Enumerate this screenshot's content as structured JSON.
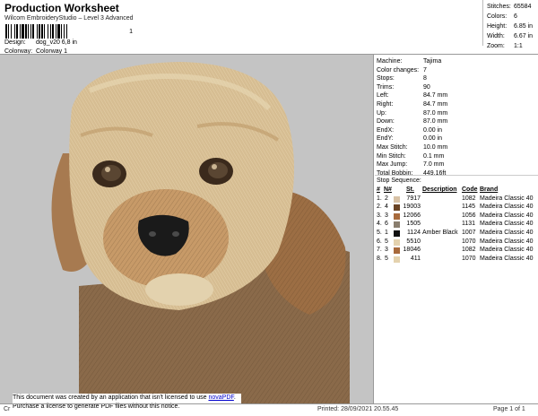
{
  "header": {
    "title": "Production Worksheet",
    "subtitle": "Wilcom EmbroideryStudio – Level 3 Advanced",
    "barcode_number": "1",
    "design_label": "Design:",
    "design_value": "dog_v20  6,8 in",
    "colorway_label": "Colorway:",
    "colorway_value": "Colorway 1"
  },
  "summary": [
    {
      "label": "Stitches:",
      "value": "65584"
    },
    {
      "label": "Colors:",
      "value": "6"
    },
    {
      "label": "Height:",
      "value": "6.85 in"
    },
    {
      "label": "Width:",
      "value": "6.67 in"
    },
    {
      "label": "Zoom:",
      "value": "1:1"
    }
  ],
  "params": [
    {
      "label": "Machine:",
      "value": "Tajima"
    },
    {
      "label": "Color changes:",
      "value": "7"
    },
    {
      "label": "Stops:",
      "value": "8"
    },
    {
      "label": "Trims:",
      "value": "90"
    },
    {
      "label": "Left:",
      "value": "84.7 mm"
    },
    {
      "label": "Right:",
      "value": "84.7 mm"
    },
    {
      "label": "Up:",
      "value": "87.0 mm"
    },
    {
      "label": "Down:",
      "value": "87.0 mm"
    },
    {
      "label": "EndX:",
      "value": "0.00 in"
    },
    {
      "label": "EndY:",
      "value": "0.00 in"
    },
    {
      "label": "Max Stitch:",
      "value": "10.0 mm"
    },
    {
      "label": "Min Stitch:",
      "value": "0.1 mm"
    },
    {
      "label": "Max Jump:",
      "value": "7.0 mm"
    },
    {
      "label": "Total Bobbin:",
      "value": "449.16ft"
    }
  ],
  "stop_sequence": {
    "heading": "Stop Sequence:",
    "columns": [
      "#",
      "N#",
      "St.",
      "Description",
      "Code",
      "Brand"
    ],
    "rows": [
      {
        "n": "1.",
        "id": "2",
        "color": "#d8c2a6",
        "st": "7917",
        "desc": "",
        "code": "1082",
        "brand": "Madeira Classic 40"
      },
      {
        "n": "2.",
        "id": "4",
        "color": "#6b4424",
        "st": "19003",
        "desc": "",
        "code": "1145",
        "brand": "Madeira Classic 40"
      },
      {
        "n": "3.",
        "id": "3",
        "color": "#a86a3c",
        "st": "12066",
        "desc": "",
        "code": "1056",
        "brand": "Madeira Classic 40"
      },
      {
        "n": "4.",
        "id": "6",
        "color": "#8a7e6e",
        "st": "1505",
        "desc": "",
        "code": "1131",
        "brand": "Madeira Classic 40"
      },
      {
        "n": "5.",
        "id": "1",
        "color": "#111111",
        "st": "1124",
        "desc": "Amber Black",
        "code": "1007",
        "brand": "Madeira Classic 40"
      },
      {
        "n": "6.",
        "id": "5",
        "color": "#e4d2ae",
        "st": "5510",
        "desc": "",
        "code": "1070",
        "brand": "Madeira Classic 40"
      },
      {
        "n": "7.",
        "id": "3",
        "color": "#a86a3c",
        "st": "18046",
        "desc": "",
        "code": "1082",
        "brand": "Madeira Classic 40"
      },
      {
        "n": "8.",
        "id": "5",
        "color": "#e4d2ae",
        "st": "411",
        "desc": "",
        "code": "1070",
        "brand": "Madeira Classic 40"
      }
    ]
  },
  "design_preview": {
    "subject": "embroidered-dog-portrait",
    "background_color": "#c4c4c4"
  },
  "notice": {
    "line1_prefix": "This document was created by an application that isn't licensed to use ",
    "line1_link": "novaPDF",
    "line1_suffix": ".",
    "line2": "Purchase a license to generate PDF files without this notice."
  },
  "footer": {
    "left": "Cr",
    "printed": "Printed: 28/09/2021 20.55.45",
    "page": "Page 1 of 1"
  }
}
